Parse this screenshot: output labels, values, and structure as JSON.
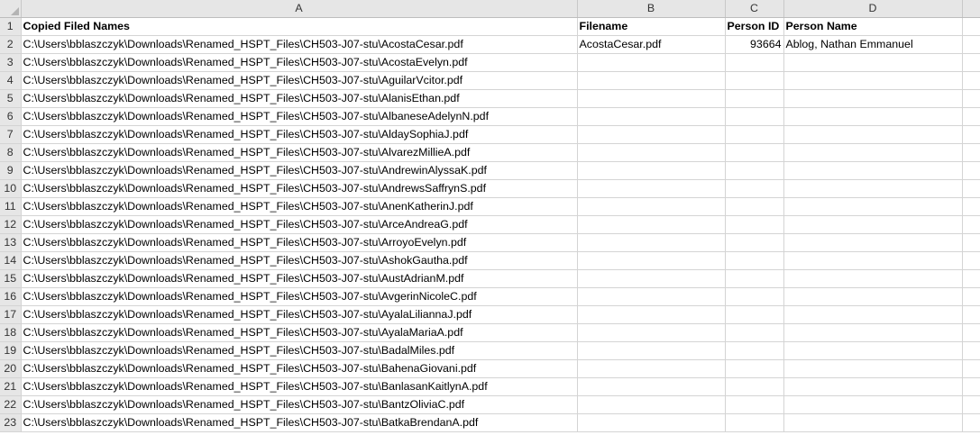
{
  "columns": [
    "A",
    "B",
    "C",
    "D"
  ],
  "headers": {
    "a": "Copied Filed Names",
    "b": "Filename",
    "c": "Person ID",
    "d": "Person Name"
  },
  "rows": [
    {
      "num": "2",
      "path": "C:\\Users\\bblaszczyk\\Downloads\\Renamed_HSPT_Files\\CH503-J07-stu\\AcostaCesar.pdf",
      "filename": "AcostaCesar.pdf",
      "person_id": "93664",
      "person_name": "Ablog, Nathan Emmanuel"
    },
    {
      "num": "3",
      "path": "C:\\Users\\bblaszczyk\\Downloads\\Renamed_HSPT_Files\\CH503-J07-stu\\AcostaEvelyn.pdf",
      "filename": "",
      "person_id": "",
      "person_name": ""
    },
    {
      "num": "4",
      "path": "C:\\Users\\bblaszczyk\\Downloads\\Renamed_HSPT_Files\\CH503-J07-stu\\AguilarVcitor.pdf",
      "filename": "",
      "person_id": "",
      "person_name": ""
    },
    {
      "num": "5",
      "path": "C:\\Users\\bblaszczyk\\Downloads\\Renamed_HSPT_Files\\CH503-J07-stu\\AlanisEthan.pdf",
      "filename": "",
      "person_id": "",
      "person_name": ""
    },
    {
      "num": "6",
      "path": "C:\\Users\\bblaszczyk\\Downloads\\Renamed_HSPT_Files\\CH503-J07-stu\\AlbaneseAdelynN.pdf",
      "filename": "",
      "person_id": "",
      "person_name": ""
    },
    {
      "num": "7",
      "path": "C:\\Users\\bblaszczyk\\Downloads\\Renamed_HSPT_Files\\CH503-J07-stu\\AldaySophiaJ.pdf",
      "filename": "",
      "person_id": "",
      "person_name": ""
    },
    {
      "num": "8",
      "path": "C:\\Users\\bblaszczyk\\Downloads\\Renamed_HSPT_Files\\CH503-J07-stu\\AlvarezMillieA.pdf",
      "filename": "",
      "person_id": "",
      "person_name": ""
    },
    {
      "num": "9",
      "path": "C:\\Users\\bblaszczyk\\Downloads\\Renamed_HSPT_Files\\CH503-J07-stu\\AndrewinAlyssaK.pdf",
      "filename": "",
      "person_id": "",
      "person_name": ""
    },
    {
      "num": "10",
      "path": "C:\\Users\\bblaszczyk\\Downloads\\Renamed_HSPT_Files\\CH503-J07-stu\\AndrewsSaffrynS.pdf",
      "filename": "",
      "person_id": "",
      "person_name": ""
    },
    {
      "num": "11",
      "path": "C:\\Users\\bblaszczyk\\Downloads\\Renamed_HSPT_Files\\CH503-J07-stu\\AnenKatherinJ.pdf",
      "filename": "",
      "person_id": "",
      "person_name": ""
    },
    {
      "num": "12",
      "path": "C:\\Users\\bblaszczyk\\Downloads\\Renamed_HSPT_Files\\CH503-J07-stu\\ArceAndreaG.pdf",
      "filename": "",
      "person_id": "",
      "person_name": ""
    },
    {
      "num": "13",
      "path": "C:\\Users\\bblaszczyk\\Downloads\\Renamed_HSPT_Files\\CH503-J07-stu\\ArroyoEvelyn.pdf",
      "filename": "",
      "person_id": "",
      "person_name": ""
    },
    {
      "num": "14",
      "path": "C:\\Users\\bblaszczyk\\Downloads\\Renamed_HSPT_Files\\CH503-J07-stu\\AshokGautha.pdf",
      "filename": "",
      "person_id": "",
      "person_name": ""
    },
    {
      "num": "15",
      "path": "C:\\Users\\bblaszczyk\\Downloads\\Renamed_HSPT_Files\\CH503-J07-stu\\AustAdrianM.pdf",
      "filename": "",
      "person_id": "",
      "person_name": ""
    },
    {
      "num": "16",
      "path": "C:\\Users\\bblaszczyk\\Downloads\\Renamed_HSPT_Files\\CH503-J07-stu\\AvgerinNicoleC.pdf",
      "filename": "",
      "person_id": "",
      "person_name": ""
    },
    {
      "num": "17",
      "path": "C:\\Users\\bblaszczyk\\Downloads\\Renamed_HSPT_Files\\CH503-J07-stu\\AyalaLiliannaJ.pdf",
      "filename": "",
      "person_id": "",
      "person_name": ""
    },
    {
      "num": "18",
      "path": "C:\\Users\\bblaszczyk\\Downloads\\Renamed_HSPT_Files\\CH503-J07-stu\\AyalaMariaA.pdf",
      "filename": "",
      "person_id": "",
      "person_name": ""
    },
    {
      "num": "19",
      "path": "C:\\Users\\bblaszczyk\\Downloads\\Renamed_HSPT_Files\\CH503-J07-stu\\BadalMiles.pdf",
      "filename": "",
      "person_id": "",
      "person_name": ""
    },
    {
      "num": "20",
      "path": "C:\\Users\\bblaszczyk\\Downloads\\Renamed_HSPT_Files\\CH503-J07-stu\\BahenaGiovani.pdf",
      "filename": "",
      "person_id": "",
      "person_name": ""
    },
    {
      "num": "21",
      "path": "C:\\Users\\bblaszczyk\\Downloads\\Renamed_HSPT_Files\\CH503-J07-stu\\BanlasanKaitlynA.pdf",
      "filename": "",
      "person_id": "",
      "person_name": ""
    },
    {
      "num": "22",
      "path": "C:\\Users\\bblaszczyk\\Downloads\\Renamed_HSPT_Files\\CH503-J07-stu\\BantzOliviaC.pdf",
      "filename": "",
      "person_id": "",
      "person_name": ""
    },
    {
      "num": "23",
      "path": "C:\\Users\\bblaszczyk\\Downloads\\Renamed_HSPT_Files\\CH503-J07-stu\\BatkaBrendanA.pdf",
      "filename": "",
      "person_id": "",
      "person_name": ""
    }
  ],
  "colors": {
    "header_bg": "#e6e6e6",
    "gridline": "#d4d4d4"
  }
}
